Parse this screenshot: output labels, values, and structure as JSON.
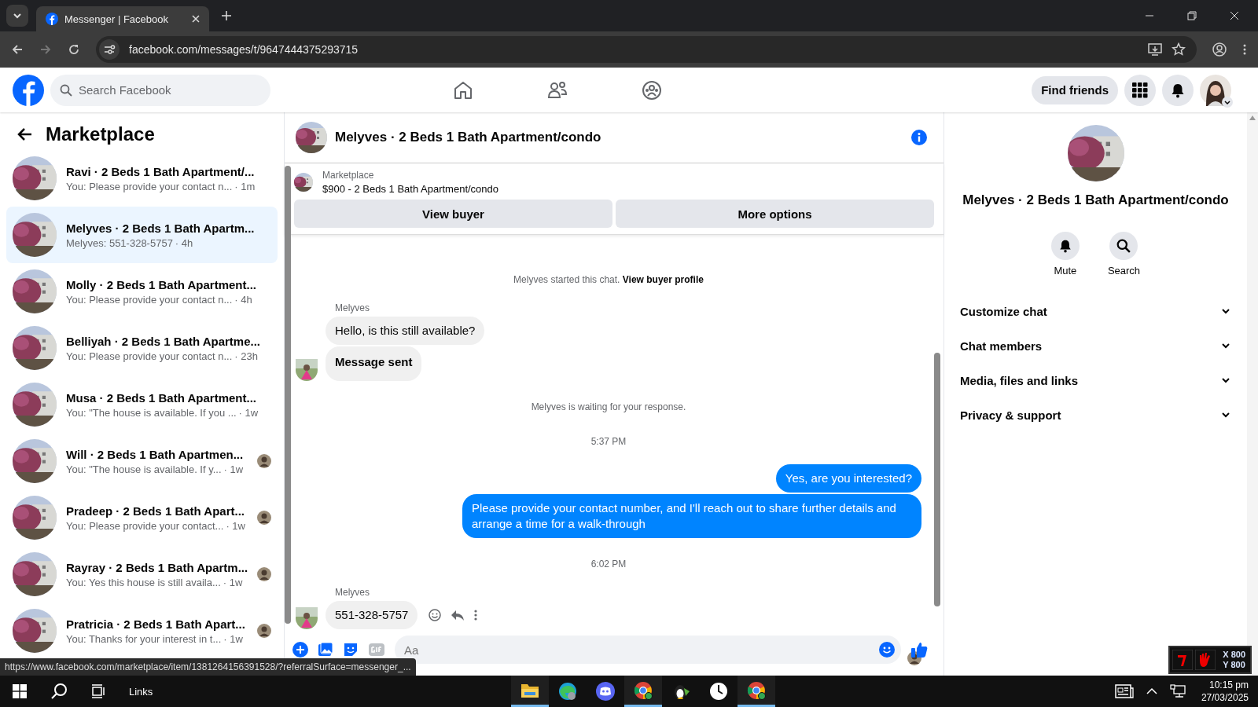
{
  "browser": {
    "tab_title": "Messenger | Facebook",
    "url": "facebook.com/messages/t/9647444375293715"
  },
  "header": {
    "search_placeholder": "Search Facebook",
    "find_friends": "Find friends"
  },
  "sidebar": {
    "title": "Marketplace",
    "conversations": [
      {
        "name": "Ravi · 2 Beds 1 Bath Apartment/...",
        "preview": "You: Please provide your contact n...",
        "time": "· 1m",
        "selected": false,
        "seen": false
      },
      {
        "name": "Melyves · 2 Beds 1 Bath Apartm...",
        "preview": "Melyves: 551-328-5757",
        "time": "· 4h",
        "selected": true,
        "seen": false
      },
      {
        "name": "Molly · 2 Beds 1 Bath Apartment...",
        "preview": "You: Please provide your contact n...",
        "time": "· 4h",
        "selected": false,
        "seen": false
      },
      {
        "name": "Belliyah · 2 Beds 1 Bath Apartme...",
        "preview": "You: Please provide your contact n...",
        "time": "· 23h",
        "selected": false,
        "seen": false
      },
      {
        "name": "Musa · 2 Beds 1 Bath Apartment...",
        "preview": "You: \"The house is available. If you ...",
        "time": "· 1w",
        "selected": false,
        "seen": false
      },
      {
        "name": "Will · 2 Beds 1 Bath Apartmen...",
        "preview": "You: \"The house is available. If y...",
        "time": "· 1w",
        "selected": false,
        "seen": true
      },
      {
        "name": "Pradeep · 2 Beds 1 Bath Apart...",
        "preview": "You: Please provide your contact...",
        "time": "· 1w",
        "selected": false,
        "seen": true
      },
      {
        "name": "Rayray · 2 Beds 1 Bath Apartm...",
        "preview": "You: Yes this house is still availa...",
        "time": "· 1w",
        "selected": false,
        "seen": true
      },
      {
        "name": "Pratricia · 2 Beds 1 Bath Apart...",
        "preview": "You: Thanks for your interest in t...",
        "time": "· 1w",
        "selected": false,
        "seen": true
      }
    ]
  },
  "chat": {
    "title": "Melyves · 2 Beds 1 Bath Apartment/condo",
    "listing": {
      "source": "Marketplace",
      "title": "$900 - 2 Beds 1 Bath Apartment/condo"
    },
    "buttons": [
      "View buyer",
      "More options"
    ],
    "messages": [
      {
        "kind": "system",
        "text": "Melyves started this chat.",
        "link": "View buyer profile"
      },
      {
        "kind": "incoming",
        "sender": "Melyves",
        "bubbles": [
          {
            "text": "Hello, is this still available?",
            "notice": false
          },
          {
            "text": "Message sent",
            "notice": true
          }
        ]
      },
      {
        "kind": "system",
        "text": "Melyves is waiting for your response."
      },
      {
        "kind": "time",
        "text": "5:37 PM"
      },
      {
        "kind": "outgoing",
        "bubbles": [
          {
            "text": "Yes, are you interested?",
            "notice": false
          },
          {
            "text": "Please provide your contact number, and I'll reach out to share further details and arrange a time for a walk-through",
            "notice": false
          }
        ]
      },
      {
        "kind": "time",
        "text": "6:02 PM"
      },
      {
        "kind": "incoming",
        "sender": "Melyves",
        "bubbles": [
          {
            "text": "551-328-5757",
            "notice": false
          }
        ],
        "actions": true
      }
    ],
    "composer_placeholder": "Aa"
  },
  "info_panel": {
    "title": "Melyves · 2 Beds 1 Bath Apartment/condo",
    "actions": [
      {
        "kind": "mute",
        "label": "Mute"
      },
      {
        "kind": "search",
        "label": "Search"
      }
    ],
    "sections": [
      "Customize chat",
      "Chat members",
      "Media, files and links",
      "Privacy & support"
    ]
  },
  "status_url": "https://www.facebook.com/marketplace/item/1381264156391528/?referralSurface=messenger_...",
  "mouse_overlay": {
    "x": "X 800",
    "y": "Y 800"
  },
  "taskbar": {
    "links": "Links",
    "apps": [
      {
        "kind": "folder",
        "running": true
      },
      {
        "kind": "edge",
        "running": false
      },
      {
        "kind": "discord",
        "running": false
      },
      {
        "kind": "chrome",
        "running": true
      },
      {
        "kind": "penguin",
        "running": false
      },
      {
        "kind": "clock",
        "running": false
      },
      {
        "kind": "chrome",
        "running": true
      }
    ],
    "time": "10:15 pm",
    "date": "27/03/2025"
  }
}
